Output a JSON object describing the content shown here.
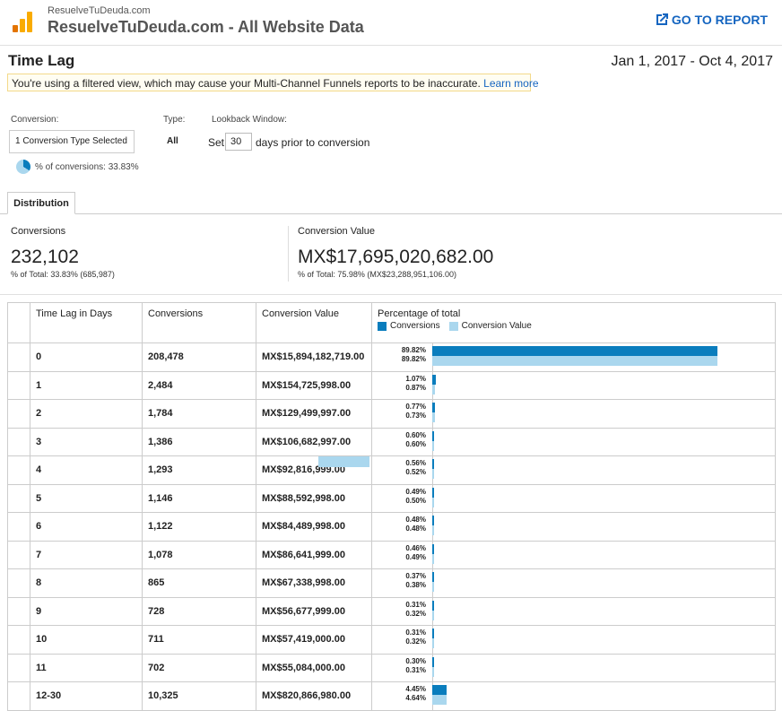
{
  "header": {
    "account_name": "ResuelveTuDeuda.com",
    "property_view": "ResuelveTuDeuda.com - All Website Data",
    "go_to_report": "GO TO REPORT",
    "go_to_report_icon": "open-in-new-icon"
  },
  "report": {
    "title": "Time Lag",
    "date_range": "Jan 1, 2017 - Oct 4, 2017",
    "warning_text": "You're using a filtered view, which may cause your Multi-Channel Funnels reports to be inaccurate.",
    "learn_more": "Learn more"
  },
  "controls": {
    "conversion_label": "Conversion:",
    "conversion_value": "1 Conversion Type Selected",
    "type_label": "Type:",
    "type_value": "All",
    "lookback_label": "Lookback Window:",
    "set_label": "Set",
    "days_value": "30",
    "days_label": "days prior to conversion",
    "pct_conversions": "% of conversions: 33.83%",
    "pct_conversions_fraction": 0.3383
  },
  "tabs": {
    "distribution": "Distribution"
  },
  "summary": {
    "conversions_label": "Conversions",
    "conversions_value": "232,102",
    "conversions_sub": "% of Total: 33.83% (685,987)",
    "value_label": "Conversion Value",
    "value_value": "MX$17,695,020,682.00",
    "value_sub": "% of Total: 75.98% (MX$23,288,951,106.00)"
  },
  "table": {
    "columns": [
      "Time Lag in Days",
      "Conversions",
      "Conversion Value",
      "Percentage of total"
    ],
    "legend": [
      "Conversions",
      "Conversion Value"
    ],
    "colors": {
      "conversions": "#0a7dbd",
      "value": "#aad7ee"
    },
    "rows": [
      {
        "lag": "0",
        "conversions": "208,478",
        "value": "MX$15,894,182,719.00",
        "pct_conv": "89.82%",
        "pct_val": "89.82%",
        "conv_frac": 0.8982,
        "val_frac": 0.8982
      },
      {
        "lag": "1",
        "conversions": "2,484",
        "value": "MX$154,725,998.00",
        "pct_conv": "1.07%",
        "pct_val": "0.87%",
        "conv_frac": 0.0107,
        "val_frac": 0.0087
      },
      {
        "lag": "2",
        "conversions": "1,784",
        "value": "MX$129,499,997.00",
        "pct_conv": "0.77%",
        "pct_val": "0.73%",
        "conv_frac": 0.0077,
        "val_frac": 0.0073
      },
      {
        "lag": "3",
        "conversions": "1,386",
        "value": "MX$106,682,997.00",
        "pct_conv": "0.60%",
        "pct_val": "0.60%",
        "conv_frac": 0.006,
        "val_frac": 0.006
      },
      {
        "lag": "4",
        "conversions": "1,293",
        "value": "MX$92,816,999.00",
        "pct_conv": "0.56%",
        "pct_val": "0.52%",
        "conv_frac": 0.0056,
        "val_frac": 0.0052
      },
      {
        "lag": "5",
        "conversions": "1,146",
        "value": "MX$88,592,998.00",
        "pct_conv": "0.49%",
        "pct_val": "0.50%",
        "conv_frac": 0.0049,
        "val_frac": 0.005
      },
      {
        "lag": "6",
        "conversions": "1,122",
        "value": "MX$84,489,998.00",
        "pct_conv": "0.48%",
        "pct_val": "0.48%",
        "conv_frac": 0.0048,
        "val_frac": 0.0048
      },
      {
        "lag": "7",
        "conversions": "1,078",
        "value": "MX$86,641,999.00",
        "pct_conv": "0.46%",
        "pct_val": "0.49%",
        "conv_frac": 0.0046,
        "val_frac": 0.0049
      },
      {
        "lag": "8",
        "conversions": "865",
        "value": "MX$67,338,998.00",
        "pct_conv": "0.37%",
        "pct_val": "0.38%",
        "conv_frac": 0.0037,
        "val_frac": 0.0038
      },
      {
        "lag": "9",
        "conversions": "728",
        "value": "MX$56,677,999.00",
        "pct_conv": "0.31%",
        "pct_val": "0.32%",
        "conv_frac": 0.0031,
        "val_frac": 0.0032
      },
      {
        "lag": "10",
        "conversions": "711",
        "value": "MX$57,419,000.00",
        "pct_conv": "0.31%",
        "pct_val": "0.32%",
        "conv_frac": 0.0031,
        "val_frac": 0.0032
      },
      {
        "lag": "11",
        "conversions": "702",
        "value": "MX$55,084,000.00",
        "pct_conv": "0.30%",
        "pct_val": "0.31%",
        "conv_frac": 0.003,
        "val_frac": 0.0031
      },
      {
        "lag": "12-30",
        "conversions": "10,325",
        "value": "MX$820,866,980.00",
        "pct_conv": "4.45%",
        "pct_val": "4.64%",
        "conv_frac": 0.0445,
        "val_frac": 0.0464
      }
    ]
  }
}
